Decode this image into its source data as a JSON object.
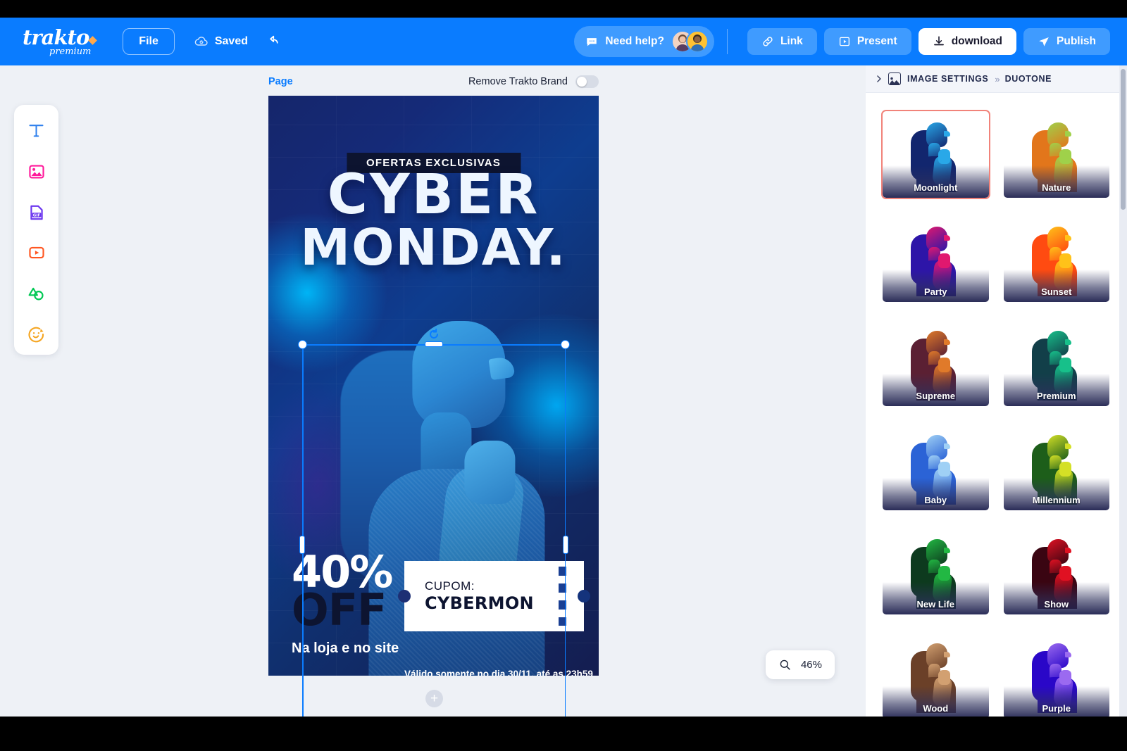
{
  "app": {
    "brand_name": "trakto",
    "brand_sub": "premium"
  },
  "header": {
    "file_label": "File",
    "saved_label": "Saved",
    "undo_icon": "undo-icon",
    "need_help_label": "Need help?",
    "buttons": [
      {
        "label": "Link",
        "icon": "link-icon",
        "style": "blue"
      },
      {
        "label": "Present",
        "icon": "present-icon",
        "style": "blue"
      },
      {
        "label": "download",
        "icon": "download-icon",
        "style": "white"
      },
      {
        "label": "Publish",
        "icon": "send-icon",
        "style": "blue"
      }
    ]
  },
  "left_rail": {
    "items": [
      {
        "name": "text-tool",
        "icon": "text-icon",
        "color": "#2f80ed"
      },
      {
        "name": "image-tool",
        "icon": "image-icon",
        "color": "#ff1a9b"
      },
      {
        "name": "gif-tool",
        "icon": "gif-icon",
        "color": "#6a35ef"
      },
      {
        "name": "video-tool",
        "icon": "video-icon",
        "color": "#ff5722"
      },
      {
        "name": "shapes-tool",
        "icon": "shapes-icon",
        "color": "#00c853"
      },
      {
        "name": "sticker-tool",
        "icon": "sticker-icon",
        "color": "#f5a623"
      }
    ]
  },
  "workspace": {
    "page_label": "Page",
    "remove_brand_label": "Remove Trakto Brand",
    "remove_brand_enabled": false,
    "add_page_label": "+",
    "zoom_level": "46%",
    "zoom_icon": "magnifier-icon"
  },
  "poster": {
    "eyebrow": "OFERTAS EXCLUSIVAS",
    "title_line1": "CYBER",
    "title_line2": "MONDAY.",
    "discount": "40%",
    "discount_sub": "OFF",
    "store_note": "Na loja e no site",
    "coupon_label": "CUPOM:",
    "coupon_code": "CYBERMON",
    "validity": "Válido somente no dia 30/11, até as 23h59"
  },
  "right_panel": {
    "breadcrumb_root": "IMAGE SETTINGS",
    "breadcrumb_current": "DUOTONE",
    "breadcrumb_sep": "»",
    "collapse_icon": "chevron-right-icon",
    "thumb_icon": "image-thumb-icon",
    "selected_preset": "Moonlight",
    "selected_border_color": "#f1837a",
    "presets": [
      {
        "label": "Moonlight",
        "dark": "#12266e",
        "light": "#29a8e8",
        "selected": true
      },
      {
        "label": "Nature",
        "dark": "#e2761b",
        "light": "#9fd14a",
        "selected": false
      },
      {
        "label": "Party",
        "dark": "#2d15a8",
        "light": "#e0186f",
        "selected": false
      },
      {
        "label": "Sunset",
        "dark": "#ff4b11",
        "light": "#ffc219",
        "selected": false
      },
      {
        "label": "Supreme",
        "dark": "#5b2033",
        "light": "#e07a2a",
        "selected": false
      },
      {
        "label": "Premium",
        "dark": "#123f49",
        "light": "#17c08a",
        "selected": false
      },
      {
        "label": "Baby",
        "dark": "#2b63d6",
        "light": "#9fd0f5",
        "selected": false
      },
      {
        "label": "Millennium",
        "dark": "#1d5e1a",
        "light": "#d4e026",
        "selected": false
      },
      {
        "label": "New Life",
        "dark": "#0d3a1e",
        "light": "#22b843",
        "selected": false
      },
      {
        "label": "Show",
        "dark": "#3a0512",
        "light": "#e01122",
        "selected": false
      },
      {
        "label": "Wood",
        "dark": "#6b4028",
        "light": "#d2a071",
        "selected": false
      },
      {
        "label": "Purple",
        "dark": "#2a07c8",
        "light": "#9b6af0",
        "selected": false
      }
    ]
  }
}
